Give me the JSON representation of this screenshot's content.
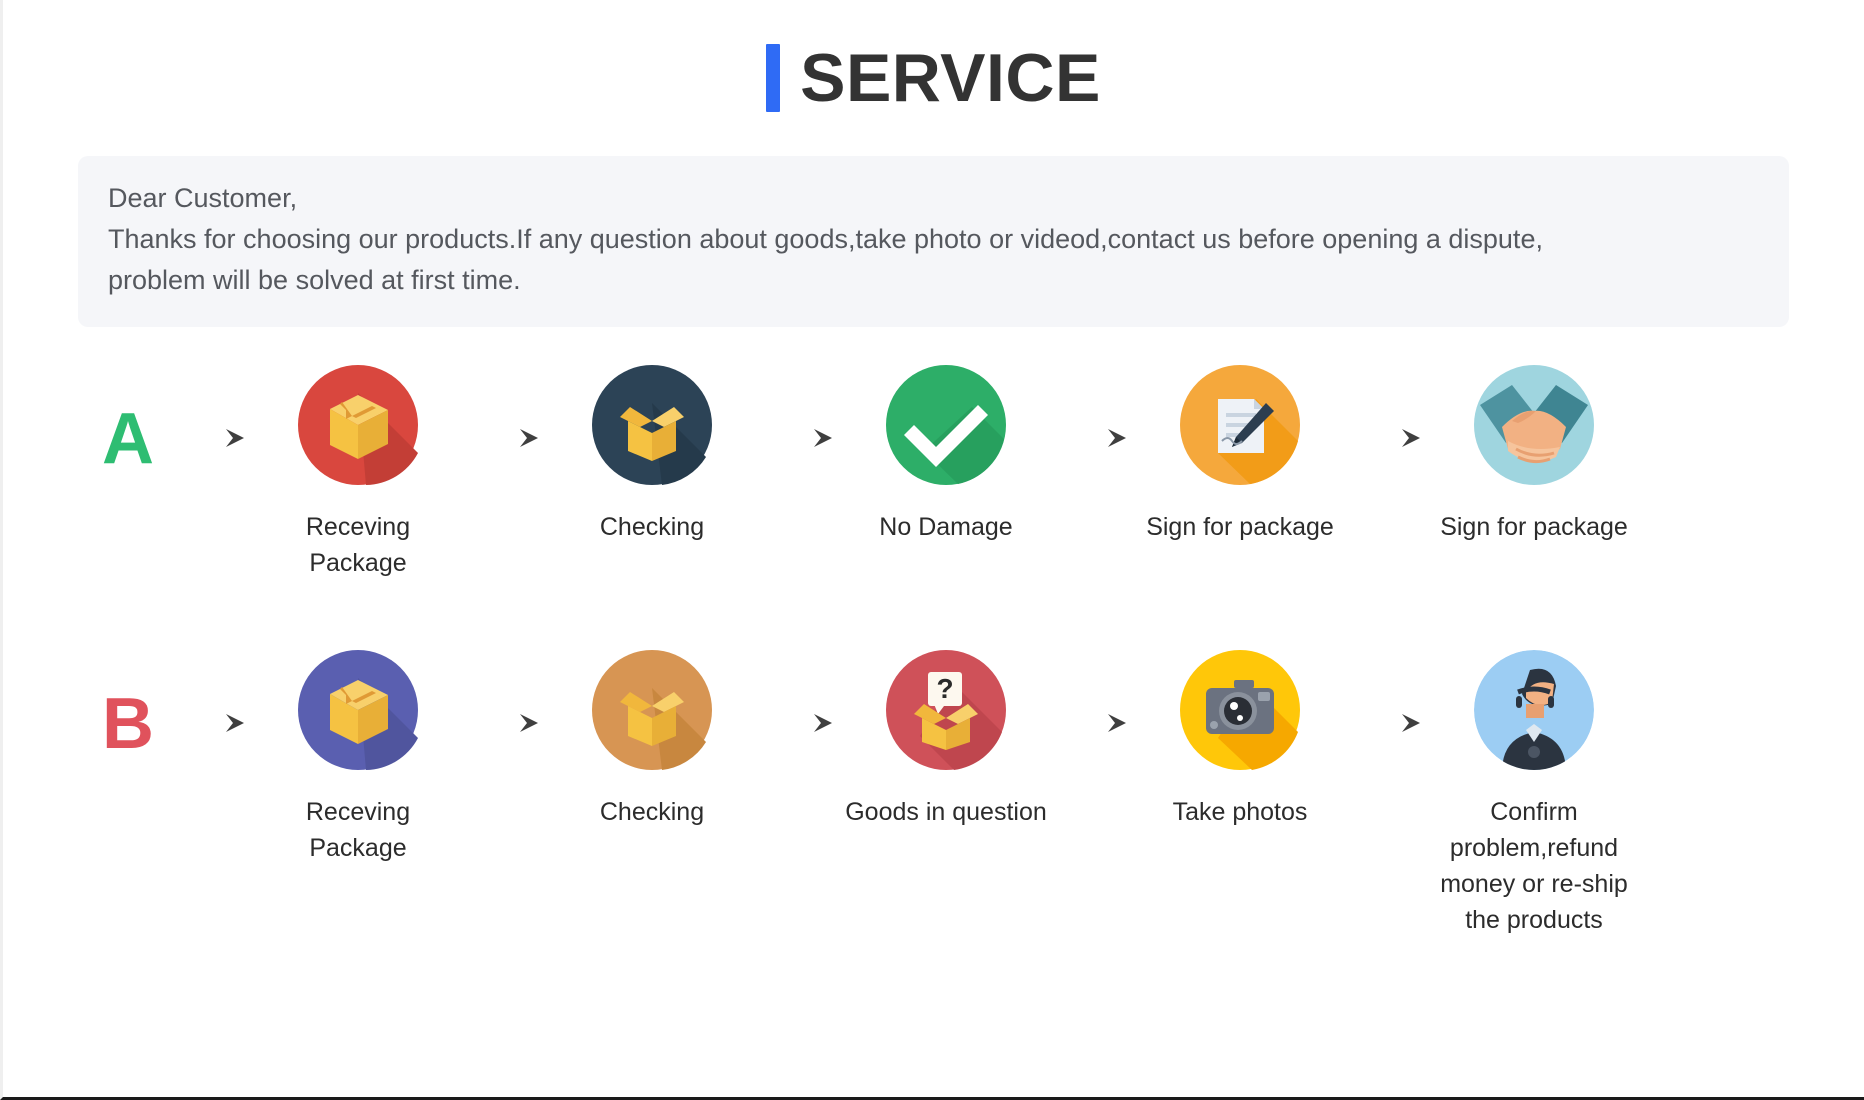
{
  "header": {
    "title": "SERVICE",
    "accent_color": "#2f6bf5"
  },
  "notice": {
    "line1": "Dear Customer,",
    "line2": "Thanks for choosing our products.If any question about goods,take photo or videod,contact us before opening a dispute,",
    "line3": "problem will be solved at first time.",
    "background_color": "#f5f6f9",
    "text_color": "#55585e"
  },
  "flows": [
    {
      "badge": "A",
      "badge_color": "#2ebd72",
      "steps": [
        {
          "label": "Receving Package",
          "icon": "package-box-icon",
          "circle_color": "#d9473e"
        },
        {
          "label": "Checking",
          "icon": "open-box-icon",
          "circle_color": "#2c4356"
        },
        {
          "label": "No Damage",
          "icon": "check-mark-icon",
          "circle_color": "#2dae68"
        },
        {
          "label": "Sign for package",
          "icon": "sign-document-icon",
          "circle_color": "#f5a83c"
        },
        {
          "label": "Sign for package",
          "icon": "handshake-icon",
          "circle_color": "#9fd5df"
        }
      ]
    },
    {
      "badge": "B",
      "badge_color": "#e0525c",
      "steps": [
        {
          "label": "Receving Package",
          "icon": "package-box-icon",
          "circle_color": "#5a5fb0"
        },
        {
          "label": "Checking",
          "icon": "open-box-icon",
          "circle_color": "#d79553"
        },
        {
          "label": "Goods in question",
          "icon": "question-box-icon",
          "circle_color": "#cf5159"
        },
        {
          "label": "Take photos",
          "icon": "camera-icon",
          "circle_color": "#ffc709"
        },
        {
          "label": "Confirm problem,refund money or re-ship the products",
          "icon": "support-agent-icon",
          "circle_color": "#9ccdf3"
        }
      ]
    }
  ],
  "arrow": {
    "name": "arrow-right-icon",
    "color": "#4a4a4a"
  }
}
